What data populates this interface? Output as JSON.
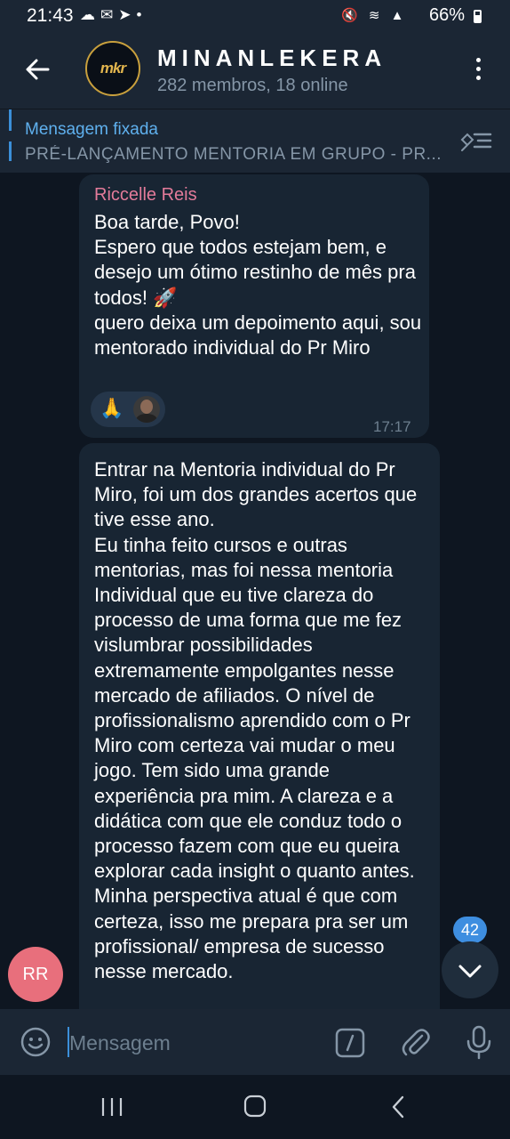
{
  "status_bar": {
    "time": "21:43",
    "battery": "66%",
    "left_icons": [
      "cloud-icon",
      "chat-icon",
      "telegram-icon",
      "dot-icon"
    ],
    "right_icons": [
      "mute-icon",
      "wifi-icon",
      "volte-icon",
      "signal-icon",
      "battery-icon"
    ]
  },
  "header": {
    "avatar_text": "mkr",
    "title": "MINANLEKERA",
    "subtitle": "282 membros, 18 online"
  },
  "pinned": {
    "label": "Mensagem fixada",
    "text": "PRÉ-LANÇAMENTO MENTORIA EM GRUPO - PR..."
  },
  "messages": [
    {
      "sender": "Riccelle Reis",
      "text": "Boa tarde, Povo!\nEspero que todos estejam bem, e desejo um ótimo restinho de mês pra todos! 🚀\nquero deixa um depoimento aqui, sou mentorado individual do Pr Miro",
      "reaction": "🙏",
      "time": "17:17"
    },
    {
      "text": "Entrar na Mentoria individual do Pr Miro, foi um dos grandes acertos que tive esse ano.\nEu tinha feito cursos e outras mentorias, mas foi nessa mentoria Individual que eu tive clareza do processo de uma forma que me fez vislumbrar possibilidades extremamente empolgantes nesse mercado de afiliados. O nível de profissionalismo aprendido com o Pr Miro com certeza vai mudar o meu jogo. Tem sido uma grande experiência pra mim. A clareza e a didática com que ele conduz todo o processo fazem com que eu queira explorar cada insight o quanto antes. Minha perspectiva atual é que com certeza, isso me prepara pra ser um profissional/ empresa de sucesso nesse mercado."
    }
  ],
  "sender_avatar": "RR",
  "unread_count": "42",
  "input": {
    "placeholder": "Mensagem"
  },
  "colors": {
    "background": "#0e1621",
    "bar": "#1b2634",
    "bubble": "#182533",
    "accent": "#3e8ee0",
    "sender_name": "#e37b9a",
    "sender_avatar": "#e86f7c"
  }
}
